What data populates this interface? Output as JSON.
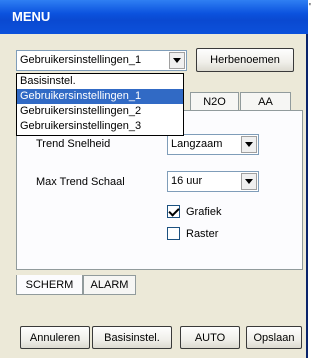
{
  "window": {
    "title": "MENU"
  },
  "profile": {
    "selected": "Gebruikersinstellingen_1",
    "rename_label": "Herbenoemen",
    "options": [
      "Basisinstel.",
      "Gebruikersinstellingen_1",
      "Gebruikersinstellingen_2",
      "Gebruikersinstellingen_3"
    ],
    "highlighted_option_index": 1
  },
  "top_tabs": [
    "N2O",
    "AA"
  ],
  "settings": {
    "trend_speed_label": "Trend Snelheid",
    "trend_speed_value": "Langzaam",
    "max_trend_scale_label": "Max Trend Schaal",
    "max_trend_scale_value": "16 uur",
    "graph_label": "Grafiek",
    "graph_checked": true,
    "grid_label": "Raster",
    "grid_checked": false
  },
  "bottom_tabs": {
    "screen": "SCHERM",
    "alarm": "ALARM",
    "active": "SCHERM"
  },
  "actions": {
    "cancel": "Annuleren",
    "defaults": "Basisinstel.",
    "auto": "AUTO",
    "save": "Opslaan"
  }
}
